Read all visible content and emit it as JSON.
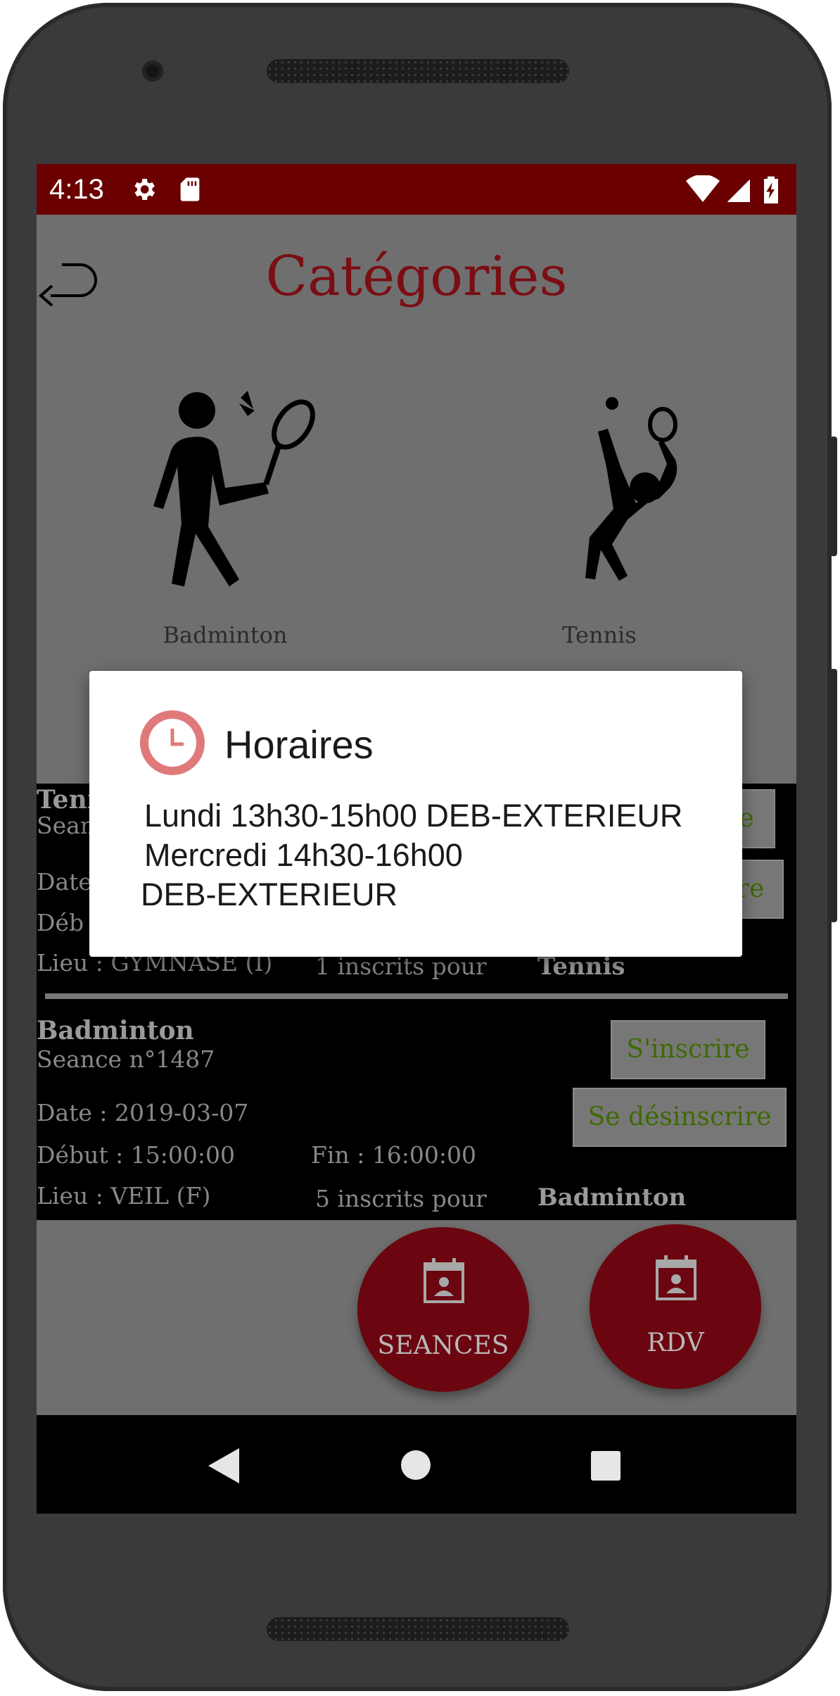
{
  "statusbar": {
    "time": "4:13",
    "icons": [
      "gear-icon",
      "sd-card-icon",
      "wifi-icon",
      "signal-icon",
      "battery-charging-icon"
    ]
  },
  "header": {
    "title": "Catégories",
    "back_icon": "back-arrow-icon"
  },
  "categories": [
    {
      "label": "Badminton",
      "icon": "badminton-player-icon"
    },
    {
      "label": "Tennis",
      "icon": "tennis-player-icon"
    }
  ],
  "sessions": [
    {
      "title": "Tenn",
      "seance": "Sean",
      "date": "Date",
      "debut": "Déb",
      "lieu": "Lieu : GYMNASE (I)",
      "inscrits": "1 inscrits pour",
      "sport": "Tennis",
      "btn_inscrire": "e",
      "btn_desinscrire": "re"
    },
    {
      "title": "Badminton",
      "seance": "Seance n°1487",
      "date": "Date : 2019-03-07",
      "debut": "Début : 15:00:00",
      "fin": "Fin : 16:00:00",
      "lieu": "Lieu : VEIL (F)",
      "inscrits": "5 inscrits pour",
      "sport": "Badminton",
      "btn_inscrire": "S'inscrire",
      "btn_desinscrire": "Se désinscrire"
    }
  ],
  "fabs": [
    {
      "label": "SEANCES",
      "icon": "calendar-contact-icon"
    },
    {
      "label": "RDV",
      "icon": "calendar-contact-icon"
    }
  ],
  "dialog": {
    "title": "Horaires",
    "icon": "clock-icon",
    "lines": [
      " Lundi 13h30-15h00 DEB-EXTERIEUR",
      " Mercredi 14h30-16h00",
      "DEB-EXTERIEUR"
    ]
  },
  "navbar": {
    "icons": [
      "back-triangle-icon",
      "home-circle-icon",
      "recents-square-icon"
    ]
  },
  "colors": {
    "statusbar": "#6b0000",
    "accent": "#7a0e14",
    "fab": "#6b0610",
    "button_text": "#3d6a00",
    "clock": "#e07a7a"
  }
}
